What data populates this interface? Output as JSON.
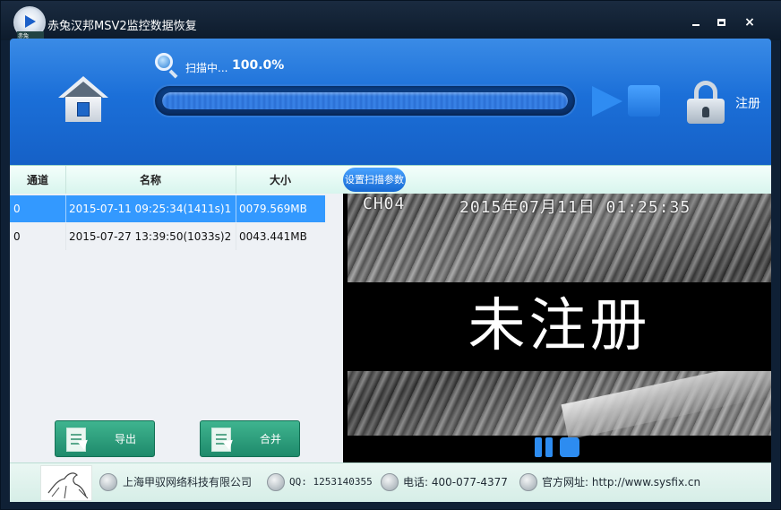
{
  "window": {
    "title": "赤兔汉邦MSV2监控数据恢复",
    "logo_label": "赤兔MSV2",
    "min_label": "minimize",
    "max_label": "maximize",
    "close_label": "×"
  },
  "header": {
    "scan_status": "扫描中...",
    "scan_percent": "100.0%",
    "progress": 1.0,
    "register_label": "注册"
  },
  "columns": {
    "channel": "通道",
    "name": "名称",
    "size": "大小",
    "scan_settings": "设置扫描参数"
  },
  "rows": [
    {
      "channel": "0",
      "name": "2015-07-11 09:25:34(1411s)1",
      "size": "0079.569MB",
      "selected": true
    },
    {
      "channel": "0",
      "name": "2015-07-27 13:39:50(1033s)2",
      "size": "0043.441MB",
      "selected": false
    }
  ],
  "actions": {
    "export_label": "导出",
    "merge_label": "合并"
  },
  "video": {
    "osd_channel": "CH04",
    "osd_timestamp": "2015年07月11日  01:25:35",
    "watermark": "未注册"
  },
  "footer": {
    "company": "上海甲驭网络科技有限公司",
    "qq": "QQ: 1253140355",
    "phone": "电话: 400-077-4377",
    "website": "官方网址: http://www.sysfix.cn"
  },
  "colors": {
    "header_blue": "#1b6fd8",
    "selected_row": "#3399ff",
    "action_green": "#2a9d7a",
    "accent_button": "#2d8cf0"
  },
  "icons": [
    "app-logo-icon",
    "home-icon",
    "search-icon",
    "play-icon",
    "stop-icon",
    "lock-icon",
    "document-export-icon",
    "document-merge-icon",
    "pause-icon",
    "company-icon",
    "qq-icon",
    "phone-icon",
    "globe-icon",
    "horse-logo"
  ]
}
